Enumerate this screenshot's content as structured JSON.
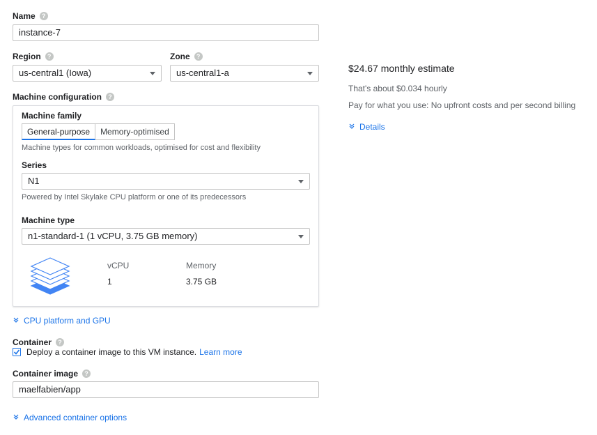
{
  "name": {
    "label": "Name",
    "value": "instance-7"
  },
  "region": {
    "label": "Region",
    "value": "us-central1 (Iowa)"
  },
  "zone": {
    "label": "Zone",
    "value": "us-central1-a"
  },
  "machine_config": {
    "label": "Machine configuration",
    "family_label": "Machine family",
    "family_tabs": [
      "General-purpose",
      "Memory-optimised"
    ],
    "selected_family": "General-purpose",
    "family_hint": "Machine types for common workloads, optimised for cost and flexibility",
    "series_label": "Series",
    "series_value": "N1",
    "series_hint": "Powered by Intel Skylake CPU platform or one of its predecessors",
    "type_label": "Machine type",
    "type_value": "n1-standard-1 (1 vCPU, 3.75 GB memory)",
    "spec": {
      "vcpu_header": "vCPU",
      "vcpu_value": "1",
      "memory_header": "Memory",
      "memory_value": "3.75 GB"
    }
  },
  "cpu_platform_link": "CPU platform and GPU",
  "container": {
    "label": "Container",
    "checkbox_text": "Deploy a container image to this VM instance.",
    "checked": true,
    "learn_more": "Learn more",
    "image_label": "Container image",
    "image_value": "maelfabien/app",
    "advanced_link": "Advanced container options"
  },
  "estimate": {
    "title": "$24.67 monthly estimate",
    "hourly": "That's about $0.034 hourly",
    "billing": "Pay for what you use: No upfront costs and per second billing",
    "details_link": "Details"
  },
  "icons": {
    "help": "help-circle-icon",
    "dropdown": "dropdown-caret-icon",
    "expand": "expand-more-icon",
    "machine": "layers-stack-icon",
    "checkbox": "checkbox-checked-icon"
  },
  "colors": {
    "accent": "#1a73e8",
    "text": "#202124",
    "muted": "#5f6368",
    "border": "#c4c4c4"
  }
}
